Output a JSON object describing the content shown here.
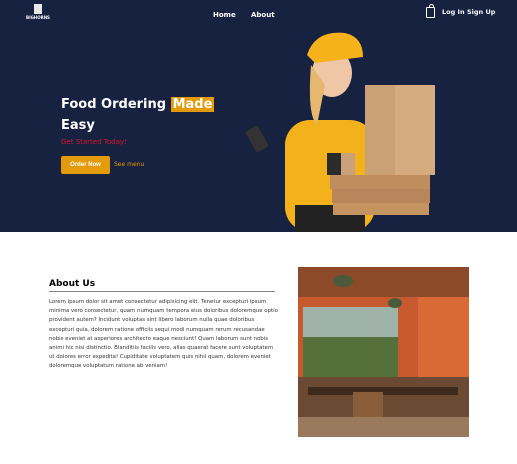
{
  "header": {
    "logo_text": "BIGHORNS",
    "nav": [
      "Home",
      "About"
    ],
    "login": "Log In",
    "signup": "Sign Up"
  },
  "hero": {
    "title_start": "Food Ordering ",
    "title_highlight": "Made",
    "title_end": "Easy",
    "subtitle": "Get Started Today!",
    "order_button": "Order Now",
    "see_menu": "See menu"
  },
  "about": {
    "heading": "About Us",
    "body": "Lorem ipsum dolor sit amet consectetur adipisicing elit. Tenetur excepturi ipsum minima vero consectetur, quam numquam tempora eius doloribus doloremque optio provident autem? Incidunt voluptas sint libero laborum nulla quae doloribus excepturi quia, dolorem ratione officiis sequi modi numquam rerum recusandae nobis eveniet at asperiores architecto eaque nesciunt! Quam laborum sunt nobis animi hic nisi distinctio. Blanditiis facilis vero, alias quaerat facere sunt voluptatem ut dolores error expedita! Cupiditate voluptatem quis nihil quam, dolorem eveniet doloremque voluptatum ratione ab veniam!"
  },
  "colors": {
    "navy": "#172140",
    "accent": "#e39a0b",
    "red": "#d4182a"
  }
}
